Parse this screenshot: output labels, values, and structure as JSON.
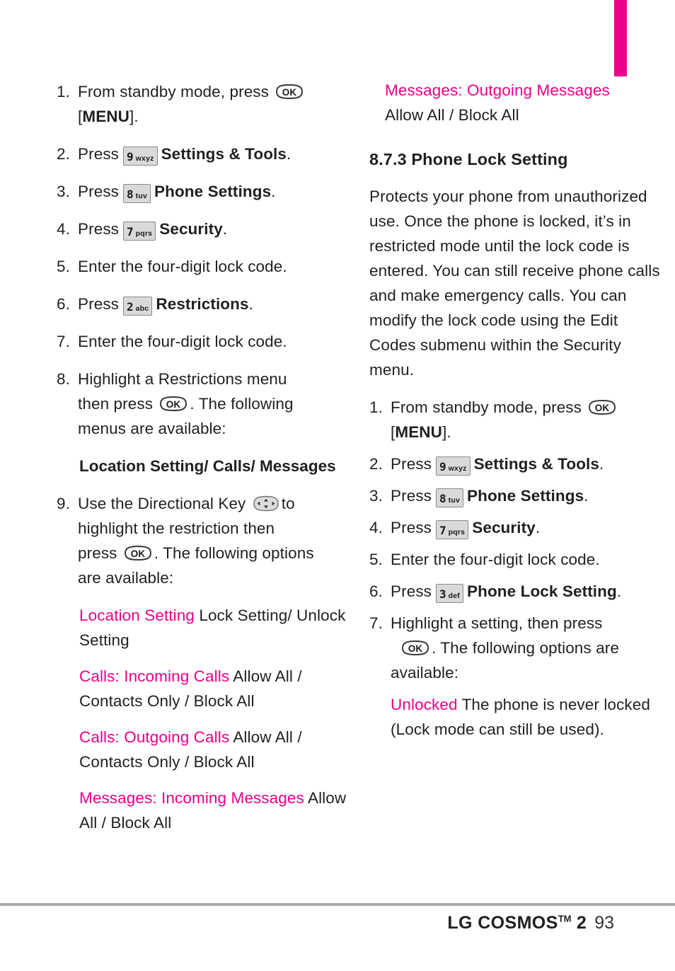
{
  "accent_color": "#EC008C",
  "text_color": "#231f20",
  "keycap_bg": "#d9d9d9",
  "rule_color": "#a9a9a9",
  "left_column": {
    "steps": [
      {
        "num": "1.",
        "text_before": "From standby mode, press",
        "icon": "ok-button",
        "text_after_lines": [
          "[MENU]."
        ],
        "after_bold": "MENU"
      },
      {
        "num": "2.",
        "text_before": "Press",
        "key_digit": "9",
        "key_letters": "wxyz",
        "bold_after": "Settings & Tools",
        "period": "."
      },
      {
        "num": "3.",
        "text_before": "Press",
        "key_digit": "8",
        "key_letters": "tuv",
        "bold_after": "Phone Settings",
        "period": "."
      },
      {
        "num": "4.",
        "text_before": "Press",
        "key_digit": "7",
        "key_letters": "pqrs",
        "bold_after": "Security",
        "period": "."
      },
      {
        "num": "5.",
        "text_before": "Enter the four-digit lock code."
      },
      {
        "num": "6.",
        "text_before": "Press",
        "key_digit": "2",
        "key_letters": "abc",
        "bold_after": "Restrictions",
        "period": "."
      },
      {
        "num": "7.",
        "text_before": "Enter the four-digit lock code."
      },
      {
        "num": "8.",
        "line1": "Highlight a Restrictions menu",
        "line2_before": "then press",
        "line2_after": ". The following",
        "line3": "menus are available:"
      },
      {
        "num": "9.",
        "line1_before": "Use the Directional Key",
        "line1_after": "to",
        "line2": "highlight the restriction then",
        "line3_before": "press",
        "line3_after": ". The following options",
        "line4": "are available:"
      }
    ],
    "menu_heading": "Location Setting/ Calls/ Messages",
    "options": [
      {
        "term": "Location Setting",
        "value": "Lock Setting/ Unlock Setting"
      },
      {
        "term": "Calls: Incoming Calls",
        "value": "Allow All / Contacts Only / Block All"
      },
      {
        "term": "Calls: Outgoing Calls",
        "value": "Allow All / Contacts Only / Block All"
      },
      {
        "term": "Messages: Incoming Messages",
        "value": "Allow All / Block All"
      }
    ]
  },
  "right_column": {
    "top_option": {
      "term": "Messages: Outgoing Messages",
      "value": "Allow All / Block All"
    },
    "section_heading": "8.7.3 Phone Lock Setting",
    "description": "Protects your phone from unauthorized use. Once the phone is locked, it’s in restricted mode until the lock code is entered. You can still receive phone calls and make emergency calls. You can modify the lock code using the Edit Codes submenu within the Security menu.",
    "steps": [
      {
        "num": "1.",
        "text_before": "From standby mode, press",
        "text_after": "[MENU].",
        "after_bold": "MENU"
      },
      {
        "num": "2.",
        "text_before": "Press",
        "key_digit": "9",
        "key_letters": "wxyz",
        "bold_after": "Settings & Tools",
        "period": "."
      },
      {
        "num": "3.",
        "text_before": "Press",
        "key_digit": "8",
        "key_letters": "tuv",
        "bold_after": "Phone Settings",
        "period": "."
      },
      {
        "num": "4.",
        "text_before": "Press",
        "key_digit": "7",
        "key_letters": "pqrs",
        "bold_after": "Security",
        "period": "."
      },
      {
        "num": "5.",
        "text_before": "Enter the four-digit lock code."
      },
      {
        "num": "6.",
        "text_before": "Press",
        "key_digit": "3",
        "key_letters": "def",
        "bold_after": "Phone Lock Setting",
        "period": "."
      },
      {
        "num": "7.",
        "line1": "Highlight a setting, then press",
        "line2_after": ". The following options are",
        "line3": "available:"
      }
    ],
    "options": [
      {
        "term": "Unlocked",
        "value": "The phone is never locked (Lock mode can still  be used)."
      }
    ]
  },
  "footer": {
    "brand": "LG COSMOS",
    "trademark": "TM",
    "model": "2",
    "page_number": "93"
  },
  "icons": {
    "ok_button": "ok-button-icon",
    "directional_key": "directional-key-icon"
  }
}
